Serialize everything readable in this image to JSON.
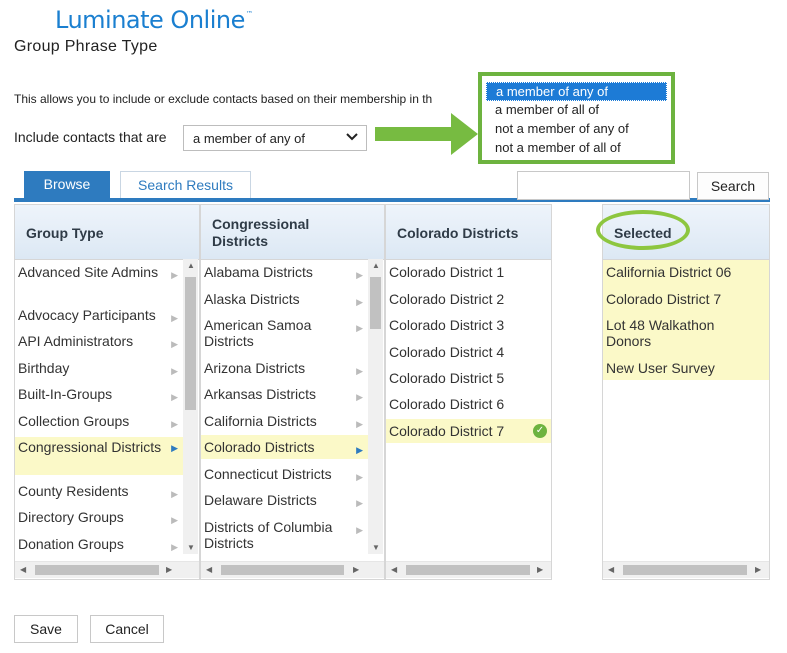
{
  "app": {
    "logo": "Luminate Online",
    "logo_mark": "™"
  },
  "page": {
    "title": "Group Phrase Type",
    "description": "This allows you to include or exclude contacts based on their membership in th",
    "include_label": "Include contacts that are"
  },
  "include_select": {
    "value": "a member of any of",
    "options": [
      "a member of any of",
      "a member of all of",
      "not a member of any of",
      "not a member of all of"
    ]
  },
  "tabs": {
    "browse": "Browse",
    "search_results": "Search Results"
  },
  "search": {
    "value": "",
    "button": "Search"
  },
  "columns": {
    "group_type": {
      "header": "Group Type",
      "items": [
        "Advanced Site Admins",
        "Advocacy Participants",
        "API Administrators",
        "Birthday",
        "Built-In-Groups",
        "Collection Groups",
        "Congressional Districts",
        "County Residents",
        "Directory Groups",
        "Donation Groups"
      ]
    },
    "congressional": {
      "header": "Congressional Districts",
      "items": [
        "Alabama Districts",
        "Alaska Districts",
        "American Samoa Districts",
        "Arizona Districts",
        "Arkansas Districts",
        "California Districts",
        "Colorado Districts",
        "Connecticut Districts",
        "Delaware Districts",
        "Districts of Columbia Districts"
      ]
    },
    "colorado": {
      "header": "Colorado Districts",
      "items": [
        "Colorado District 1",
        "Colorado District 2",
        "Colorado District 3",
        "Colorado District 4",
        "Colorado District 5",
        "Colorado District 6",
        "Colorado District 7"
      ]
    },
    "selected": {
      "header": "Selected",
      "items": [
        "California District 06",
        "Colorado District 7",
        "Lot 48 Walkathon Donors",
        "New User Survey"
      ]
    }
  },
  "footer": {
    "save": "Save",
    "cancel": "Cancel"
  },
  "colors": {
    "accent": "#2e7bbf",
    "highlight_green": "#6db33f",
    "selected_row": "#fbf9c8",
    "dropdown_selected": "#1d7bd6"
  },
  "icons": [
    "right-arrow-annotation",
    "chevron-down-icon",
    "checkmark-icon",
    "expand-triangle-icon",
    "scroll-arrow-icon"
  ]
}
